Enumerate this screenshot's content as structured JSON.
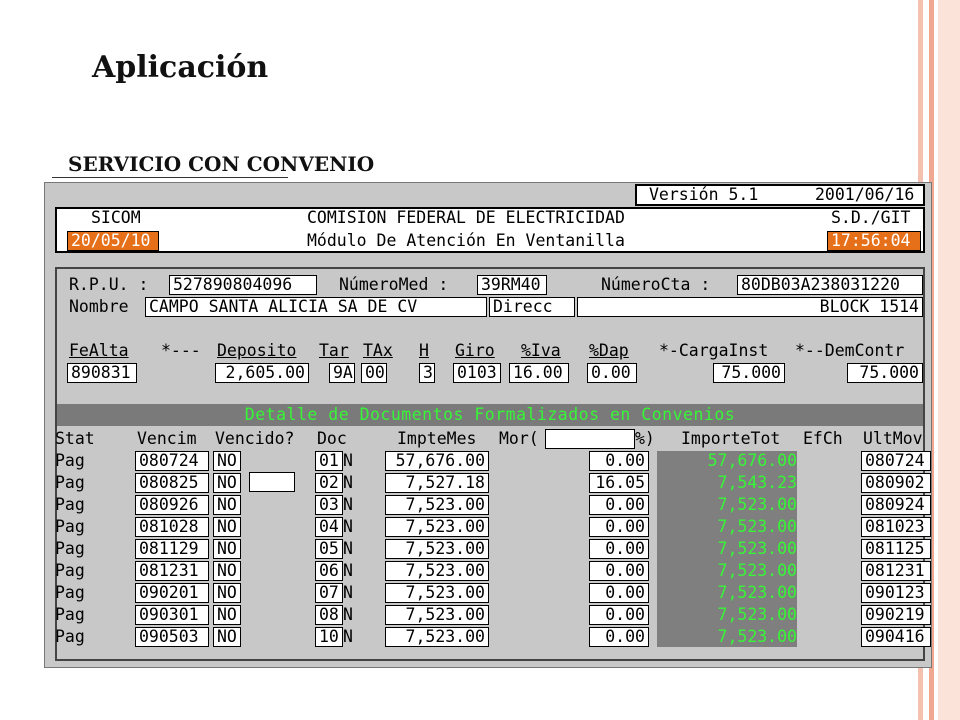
{
  "slide": {
    "title": "Aplicación",
    "subtitle": "SERVICIO CON CONVENIO"
  },
  "colors": {
    "terminal_bg": "#c8c8c8",
    "highlight_orange": "#e6701a",
    "detail_bar_grey": "#7a7a7a",
    "green_text": "#37f537",
    "slide_edge_pink": "#f0a890"
  },
  "header": {
    "version_label": "Versión 5.1",
    "version_date": "2001/06/16",
    "system": "SICOM",
    "company": "COMISION FEDERAL DE ELECTRICIDAD",
    "department": "S.D./GIT",
    "date": "20/05/10",
    "module": "Módulo De Atención En Ventanilla",
    "time": "17:56:04"
  },
  "account": {
    "rpu_label": "R.P.U. :",
    "rpu_value": "527890804096",
    "med_label": "NúmeroMed :",
    "med_value": "39RM40",
    "cta_label": "NúmeroCta :",
    "cta_value": "80DB03A238031220",
    "nombre_label": "Nombre",
    "nombre_value": "CAMPO SANTA ALICIA SA DE CV",
    "direcc_label": "Direcc",
    "direcc_value": "BLOCK 1514"
  },
  "service": {
    "labels": [
      "FeAlta",
      "*---",
      "Deposito",
      "Tar",
      "TAx",
      "H",
      "Giro",
      "%Iva",
      "%Dap",
      "*-CargaInst",
      "*--DemContr"
    ],
    "fealta": "890831",
    "deposito": "2,605.00",
    "tar": "9A",
    "tax": "00",
    "h": "3",
    "giro": "0103",
    "iva": "16.00",
    "dap": "0.00",
    "carga_inst": "75.000",
    "dem_contr": "75.000"
  },
  "detail": {
    "bar_title": "Detalle de Documentos Formalizados en Convenios",
    "columns": {
      "stat": "Stat",
      "vencim": "Vencim",
      "vencido": "Vencido?",
      "doc": "Doc",
      "imptemes": "ImpteMes",
      "mor": "Mor(",
      "pct": "%)",
      "importetot": "ImporteTot",
      "efch": "EfCh",
      "ultmov": "UltMov"
    },
    "rows": [
      {
        "stat": "Pag",
        "vencim": "080724",
        "vencido": "NO",
        "doc": "01",
        "tipo": "N",
        "imptemes": "57,676.00",
        "mor": "0.00",
        "importetot": "57,676.00",
        "ultmov": "080724"
      },
      {
        "stat": "Pag",
        "vencim": "080825",
        "vencido": "NO",
        "doc": "02",
        "tipo": "N",
        "imptemes": "7,527.18",
        "mor": "16.05",
        "importetot": "7,543.23",
        "ultmov": "080902"
      },
      {
        "stat": "Pag",
        "vencim": "080926",
        "vencido": "NO",
        "doc": "03",
        "tipo": "N",
        "imptemes": "7,523.00",
        "mor": "0.00",
        "importetot": "7,523.00",
        "ultmov": "080924"
      },
      {
        "stat": "Pag",
        "vencim": "081028",
        "vencido": "NO",
        "doc": "04",
        "tipo": "N",
        "imptemes": "7,523.00",
        "mor": "0.00",
        "importetot": "7,523.00",
        "ultmov": "081023"
      },
      {
        "stat": "Pag",
        "vencim": "081129",
        "vencido": "NO",
        "doc": "05",
        "tipo": "N",
        "imptemes": "7,523.00",
        "mor": "0.00",
        "importetot": "7,523.00",
        "ultmov": "081125"
      },
      {
        "stat": "Pag",
        "vencim": "081231",
        "vencido": "NO",
        "doc": "06",
        "tipo": "N",
        "imptemes": "7,523.00",
        "mor": "0.00",
        "importetot": "7,523.00",
        "ultmov": "081231"
      },
      {
        "stat": "Pag",
        "vencim": "090201",
        "vencido": "NO",
        "doc": "07",
        "tipo": "N",
        "imptemes": "7,523.00",
        "mor": "0.00",
        "importetot": "7,523.00",
        "ultmov": "090123"
      },
      {
        "stat": "Pag",
        "vencim": "090301",
        "vencido": "NO",
        "doc": "08",
        "tipo": "N",
        "imptemes": "7,523.00",
        "mor": "0.00",
        "importetot": "7,523.00",
        "ultmov": "090219"
      },
      {
        "stat": "Pag",
        "vencim": "090503",
        "vencido": "NO",
        "doc": "10",
        "tipo": "N",
        "imptemes": "7,523.00",
        "mor": "0.00",
        "importetot": "7,523.00",
        "ultmov": "090416"
      }
    ]
  }
}
